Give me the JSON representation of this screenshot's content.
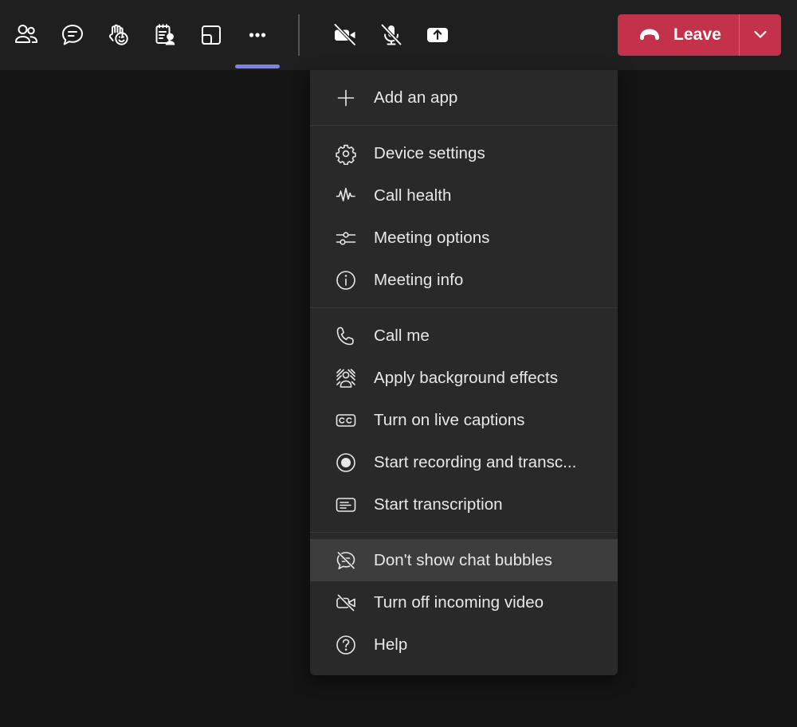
{
  "toolbar": {
    "background_color": "#1f1f1f",
    "buttons": [
      {
        "name": "people",
        "label": "People",
        "icon": "people-icon",
        "active": false
      },
      {
        "name": "chat",
        "label": "Chat",
        "icon": "chat-icon",
        "active": false
      },
      {
        "name": "reactions",
        "label": "Reactions",
        "icon": "raise-hand-reactions-icon",
        "active": false
      },
      {
        "name": "notes",
        "label": "Notes",
        "icon": "notes-person-icon",
        "active": false
      },
      {
        "name": "rooms",
        "label": "Rooms",
        "icon": "breakout-rooms-icon",
        "active": false
      },
      {
        "name": "more",
        "label": "More",
        "icon": "more-ellipsis-icon",
        "active": true
      }
    ],
    "media_buttons": [
      {
        "name": "camera",
        "label": "Camera",
        "icon": "camera-off-icon",
        "state": "off"
      },
      {
        "name": "microphone",
        "label": "Microphone",
        "icon": "mic-off-icon",
        "state": "muted"
      },
      {
        "name": "share",
        "label": "Share content",
        "icon": "share-up-arrow-icon",
        "state": "available"
      }
    ],
    "leave": {
      "label": "Leave",
      "icon": "hangup-phone-icon",
      "chevron_icon": "chevron-down-icon",
      "color": "#c4314b"
    },
    "active_indicator_color": "#7b83eb"
  },
  "menu": {
    "background_color": "#292929",
    "highlight_color": "#3d3d3d",
    "sections": [
      {
        "name": "apps",
        "items": [
          {
            "label": "Add an app",
            "icon": "plus-icon",
            "highlighted": false
          }
        ]
      },
      {
        "name": "settings",
        "items": [
          {
            "label": "Device settings",
            "icon": "gear-icon",
            "highlighted": false
          },
          {
            "label": "Call health",
            "icon": "pulse-icon",
            "highlighted": false
          },
          {
            "label": "Meeting options",
            "icon": "sliders-icon",
            "highlighted": false
          },
          {
            "label": "Meeting info",
            "icon": "info-circle-icon",
            "highlighted": false
          }
        ]
      },
      {
        "name": "call-features",
        "items": [
          {
            "label": "Call me",
            "icon": "phone-icon",
            "highlighted": false
          },
          {
            "label": "Apply background effects",
            "icon": "background-effects-icon",
            "highlighted": false
          },
          {
            "label": "Turn on live captions",
            "icon": "closed-captions-icon",
            "highlighted": false
          },
          {
            "label": "Start recording and transc...",
            "icon": "record-circle-icon",
            "highlighted": false
          },
          {
            "label": "Start transcription",
            "icon": "transcription-icon",
            "highlighted": false
          }
        ]
      },
      {
        "name": "view-and-help",
        "items": [
          {
            "label": "Don't show chat bubbles",
            "icon": "chat-bubble-off-icon",
            "highlighted": true
          },
          {
            "label": "Turn off incoming video",
            "icon": "incoming-video-off-icon",
            "highlighted": false
          },
          {
            "label": "Help",
            "icon": "question-circle-icon",
            "highlighted": false
          }
        ]
      }
    ]
  }
}
